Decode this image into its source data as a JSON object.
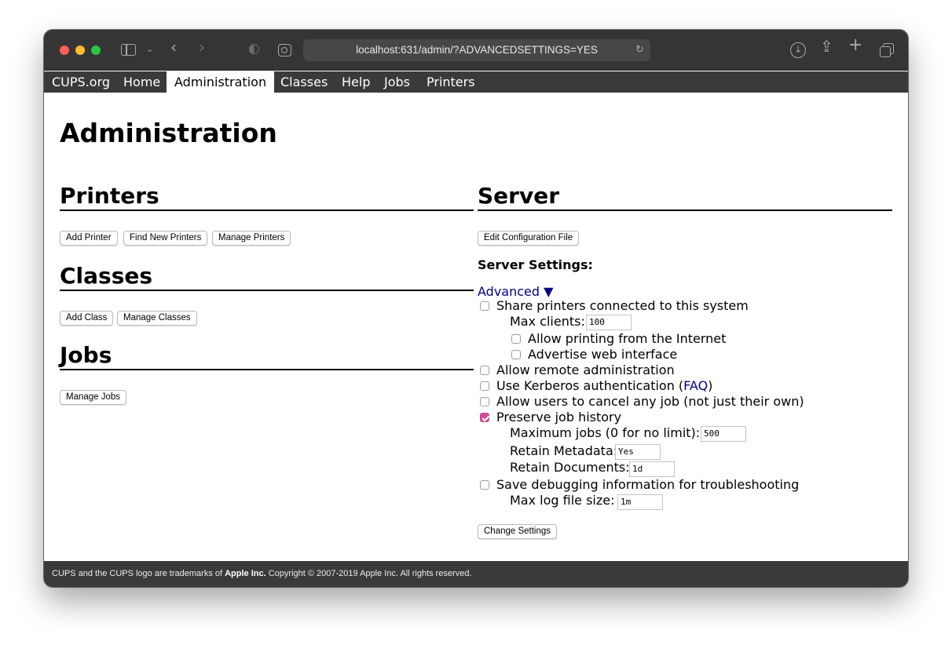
{
  "browser": {
    "url": "localhost:631/admin/?ADVANCEDSETTINGS=YES"
  },
  "nav": {
    "items": [
      "CUPS.org",
      "Home",
      "Administration",
      "Classes",
      "Help",
      "Jobs",
      "Printers"
    ],
    "active": "Administration"
  },
  "page": {
    "title": "Administration"
  },
  "printers": {
    "heading": "Printers",
    "buttons": [
      "Add Printer",
      "Find New Printers",
      "Manage Printers"
    ]
  },
  "classes": {
    "heading": "Classes",
    "buttons": [
      "Add Class",
      "Manage Classes"
    ]
  },
  "jobs": {
    "heading": "Jobs",
    "buttons": [
      "Manage Jobs"
    ]
  },
  "server": {
    "heading": "Server",
    "edit_config_label": "Edit Configuration File",
    "settings_label": "Server Settings:",
    "advanced_toggle": "Advanced ▼",
    "share_printers": {
      "label": "Share printers connected to this system",
      "checked": false
    },
    "max_clients": {
      "label": "Max clients:",
      "value": "100"
    },
    "allow_internet": {
      "label": "Allow printing from the Internet",
      "checked": false
    },
    "advertise_web": {
      "label": "Advertise web interface",
      "checked": false
    },
    "remote_admin": {
      "label": "Allow remote administration",
      "checked": false
    },
    "kerberos": {
      "label_before": "Use Kerberos authentication (",
      "link": "FAQ",
      "label_after": ")",
      "checked": false
    },
    "cancel_any": {
      "label": "Allow users to cancel any job (not just their own)",
      "checked": false
    },
    "preserve_history": {
      "label": "Preserve job history",
      "checked": true
    },
    "max_jobs": {
      "label": "Maximum jobs (0 for no limit):",
      "value": "500"
    },
    "retain_metadata": {
      "label": "Retain Metadata:",
      "value": "Yes"
    },
    "retain_documents": {
      "label": "Retain Documents:",
      "value": "1d"
    },
    "debug_logging": {
      "label": "Save debugging information for troubleshooting",
      "checked": false
    },
    "max_log_size": {
      "label": "Max log file size:",
      "value": "1m"
    },
    "change_settings_label": "Change Settings"
  },
  "footer": {
    "text_before": "CUPS and the CUPS logo are trademarks of ",
    "brand": "Apple Inc.",
    "text_after": " Copyright © 2007-2019 Apple Inc. All rights reserved."
  },
  "colors": {
    "nav_bar": "#3a3a3a",
    "link": "#000080",
    "checkbox_checked": "#d64e98"
  }
}
